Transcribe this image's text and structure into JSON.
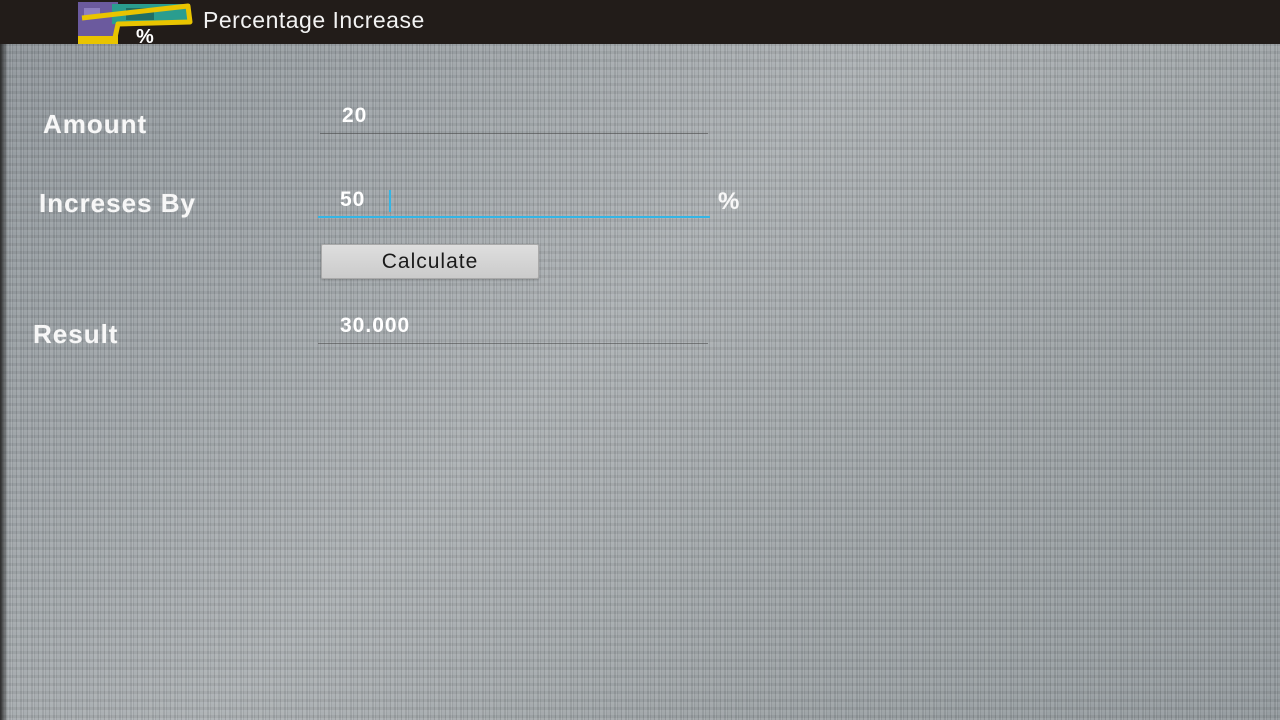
{
  "app": {
    "title": "Percentage Increase",
    "icon": "percent-chart-icon",
    "icon_text": "%"
  },
  "form": {
    "amount_label": "Amount",
    "amount_value": "20",
    "increase_label": "Increses By",
    "increase_value": "50",
    "percent_sign": "%",
    "calculate_label": "Calculate",
    "result_label": "Result",
    "result_value": "30.000"
  },
  "colors": {
    "action_bar": "#221c19",
    "focus_accent": "#33b5e5",
    "icon_purple": "#6b5a9e",
    "icon_teal": "#2a9d8f",
    "icon_yellow": "#e9c400"
  }
}
